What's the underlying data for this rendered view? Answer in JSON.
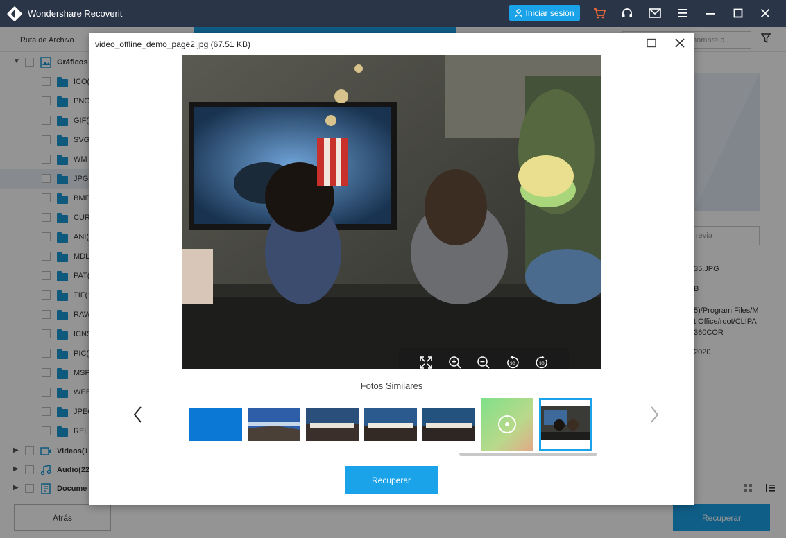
{
  "window": {
    "title": "Wondershare Recoverit",
    "login_label": "Iniciar sesión"
  },
  "toolbar": {
    "path_label": "Ruta de Archivo",
    "search_placeholder": "nombre d..."
  },
  "sidebar": {
    "root_label": "Gráficos",
    "items": [
      {
        "label": "ICO("
      },
      {
        "label": "PNG"
      },
      {
        "label": "GIF("
      },
      {
        "label": "SVG"
      },
      {
        "label": "WM"
      },
      {
        "label": "JPG("
      },
      {
        "label": "BMP"
      },
      {
        "label": "CUR"
      },
      {
        "label": "ANI("
      },
      {
        "label": "MDL"
      },
      {
        "label": "PAT("
      },
      {
        "label": "TIF(1"
      },
      {
        "label": "RAW"
      },
      {
        "label": "ICNS"
      },
      {
        "label": "PIC("
      },
      {
        "label": "MSP"
      },
      {
        "label": "WEB"
      },
      {
        "label": "JPEG"
      },
      {
        "label": "RELS"
      }
    ],
    "categories": [
      {
        "label": "Videos(1"
      },
      {
        "label": "Audio(22"
      },
      {
        "label": "Docume"
      }
    ]
  },
  "right_panel": {
    "preview_button": "revia",
    "file_name": "35.JPG",
    "size": "B",
    "path_line1": "5)/Program Files/M",
    "path_line2": "t Office/root/CLIPA",
    "path_line3": "360COR",
    "date": "2020"
  },
  "modal": {
    "title": "video_offline_demo_page2.jpg (67.51 KB)",
    "similar_label": "Fotos Similares",
    "recover_label": "Recuperar"
  },
  "footer": {
    "back_label": "Atrás",
    "recover_label": "Recuperar"
  },
  "colors": {
    "titlebar": "#2b3548",
    "accent": "#1aa3e8",
    "folder": "#1a9ad8"
  }
}
